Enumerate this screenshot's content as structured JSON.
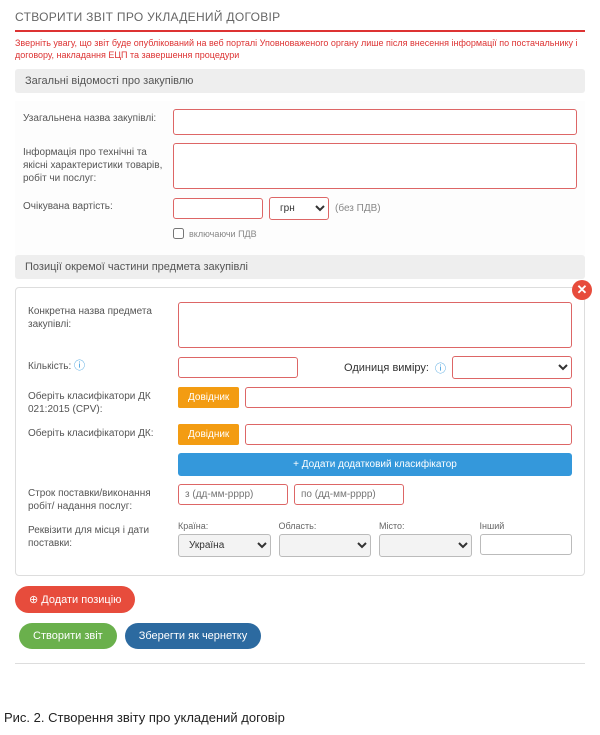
{
  "title": "СТВОРИТИ ЗВІТ ПРО УКЛАДЕНИЙ ДОГОВІР",
  "warning": "Зверніть увагу, що звіт буде опублікований на веб порталі Уповноваженого органу лише після внесення інформації по постачальнику і договору, накладання ЕЦП та завершення процедури",
  "section1": {
    "header": "Загальні відомості про закупівлю",
    "name_label": "Узагальнена назва закупівлі:",
    "info_label": "Інформація про технічні та якісні характеристики товарів, робіт чи послуг:",
    "price_label": "Очікувана вартість:",
    "currency": "грн",
    "vat_note": "(без ПДВ)",
    "vat_checkbox": "включаючи ПДВ"
  },
  "section2": {
    "header": "Позиції окремої частини предмета закупівлі",
    "item_name_label": "Конкретна назва предмета закупівлі:",
    "qty_label": "Кількість:",
    "unit_label": "Одиниця виміру:",
    "cpv_label": "Оберіть класифікатори ДК 021:2015 (CPV):",
    "dk_label": "Оберіть класифікатори ДК:",
    "lookup_btn": "Довідник",
    "add_classifier": "+ Додати додатковий класифікатор",
    "delivery_label": "Строк поставки/виконання робіт/ надання послуг:",
    "date_from_ph": "з (дд-мм-рррр)",
    "date_to_ph": "по (дд-мм-рррр)",
    "location_label": "Реквізити для місця і дати поставки:",
    "country_label": "Країна:",
    "country_value": "Україна",
    "region_label": "Область:",
    "city_label": "Місто:",
    "other_label": "Інший"
  },
  "buttons": {
    "add_position": "⊕ Додати позицію",
    "create": "Створити звіт",
    "draft": "Зберегти як чернетку"
  },
  "caption": "Рис. 2. Створення звіту про укладений договір"
}
